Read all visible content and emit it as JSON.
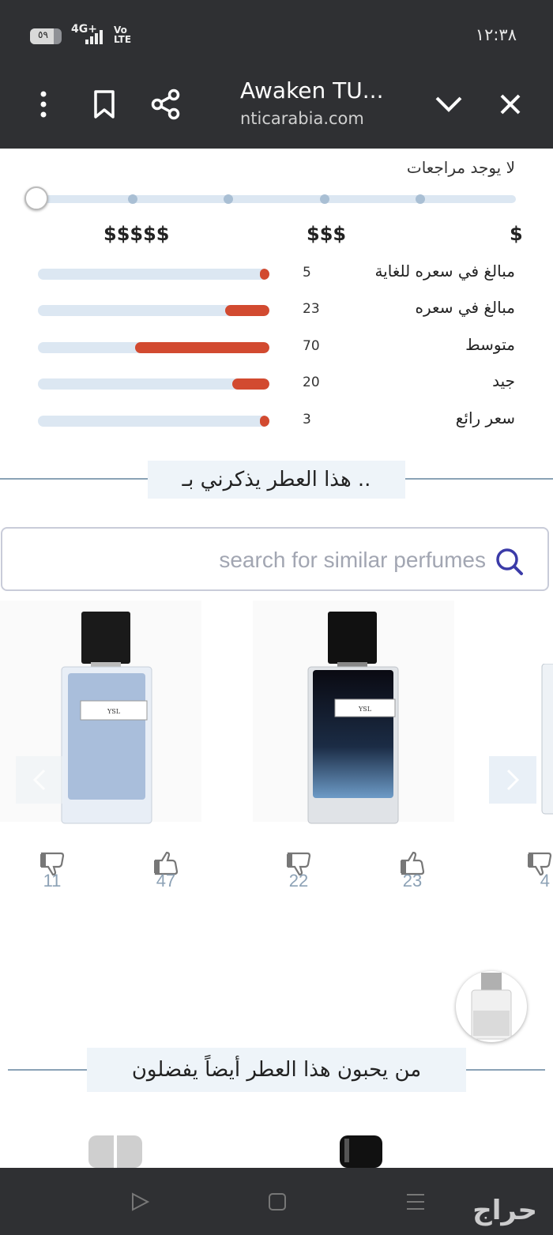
{
  "status_bar": {
    "time": "١٢:٣٨",
    "battery": "٥٩",
    "network": "4G+",
    "volte": "Vo LTE"
  },
  "browser": {
    "title": "Awaken TU...",
    "url": "nticarabia.com"
  },
  "price_section": {
    "no_reviews": "لا يوجد مراجعات",
    "scale_labels": [
      "$$$$$",
      "$$$",
      "$"
    ],
    "ratings": [
      {
        "label": "مبالغ في سعره للغاية",
        "count": "5",
        "fraction": 0.02
      },
      {
        "label": "مبالغ في سعره",
        "count": "23",
        "fraction": 0.19
      },
      {
        "label": "متوسط",
        "count": "70",
        "fraction": 0.58
      },
      {
        "label": "جيد",
        "count": "20",
        "fraction": 0.16
      },
      {
        "label": "سعر رائع",
        "count": "3",
        "fraction": 0.02
      }
    ]
  },
  "reminds_section": {
    "title": "هذا العطر يذكرني بـ .."
  },
  "search": {
    "placeholder": "search for similar perfumes",
    "value": ""
  },
  "similar_perfumes": [
    {
      "dislikes": "11",
      "likes": "47"
    },
    {
      "dislikes": "22",
      "likes": "23"
    },
    {
      "dislikes": "4"
    }
  ],
  "also_like_section": {
    "title": "من يحبون هذا العطر أيضاً يفضلون"
  },
  "watermark": "حراج",
  "colors": {
    "chrome": "#2f3033",
    "accent_bar": "#d24a30",
    "track": "#dce7f2",
    "search_icon": "#3b3ba8"
  }
}
